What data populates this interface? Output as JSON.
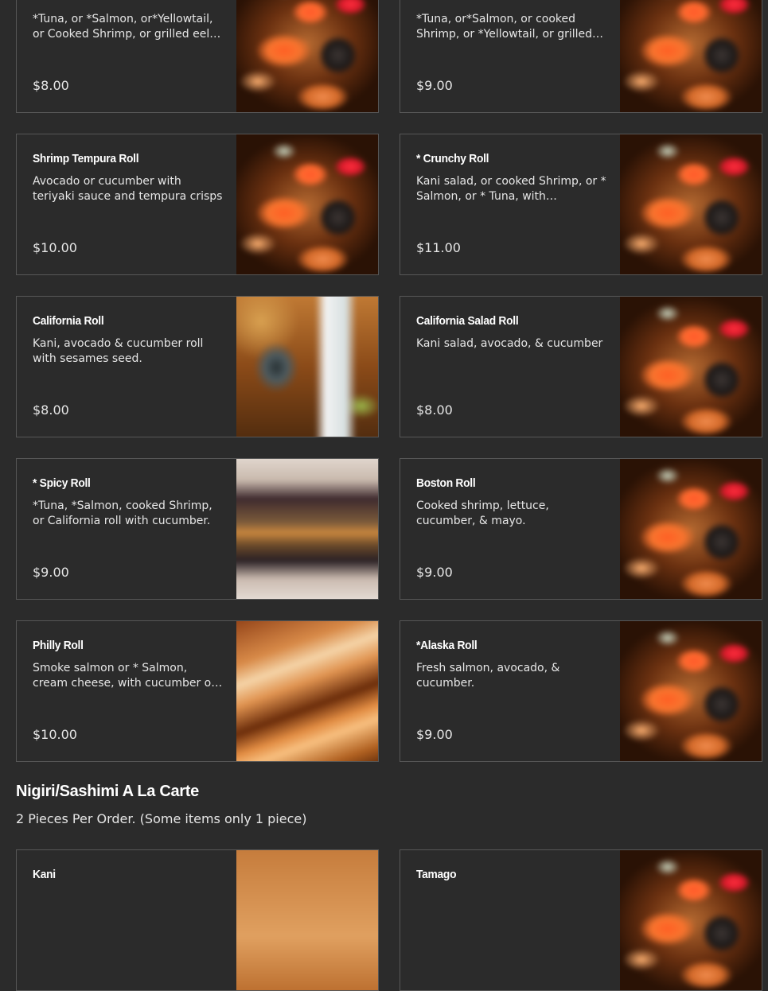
{
  "menu": {
    "items": [
      {
        "name": "",
        "desc": "*Tuna, or *Salmon, or*Yellowtail, or Cooked Shrimp, or grilled eel with...",
        "price": "$8.00"
      },
      {
        "name": "",
        "desc": "*Tuna, or*Salmon, or cooked Shrimp, or *Yellowtail, or grilled e...",
        "price": "$9.00"
      },
      {
        "name": "Shrimp Tempura Roll",
        "desc": "Avocado or cucumber with teriyaki sauce and tempura crisps",
        "price": "$10.00"
      },
      {
        "name": "* Crunchy Roll",
        "desc": "Kani salad, or cooked Shrimp, or * Salmon, or * Tuna, with cucumbe...",
        "price": "$11.00"
      },
      {
        "name": "California Roll",
        "desc": "Kani, avocado & cucumber roll with sesames seed.",
        "price": "$8.00"
      },
      {
        "name": "California Salad Roll",
        "desc": "Kani salad, avocado, & cucumber",
        "price": "$8.00"
      },
      {
        "name": "* Spicy Roll",
        "desc": "*Tuna, *Salmon, cooked Shrimp, or California roll with cucumber.",
        "price": "$9.00"
      },
      {
        "name": "Boston Roll",
        "desc": "Cooked shrimp, lettuce, cucumber, & mayo.",
        "price": "$9.00"
      },
      {
        "name": "Philly Roll",
        "desc": "Smoke salmon or * Salmon, cream cheese, with cucumber or avocado",
        "price": "$10.00"
      },
      {
        "name": "*Alaska Roll",
        "desc": "Fresh salmon, avocado, & cucumber.",
        "price": "$9.00"
      }
    ]
  },
  "section": {
    "title": "Nigiri/Sashimi A La Carte",
    "subtitle": "2 Pieces Per Order. (Some items only 1 piece)",
    "items": [
      {
        "name": "Kani",
        "desc": ""
      },
      {
        "name": "Tamago",
        "desc": ""
      }
    ]
  }
}
